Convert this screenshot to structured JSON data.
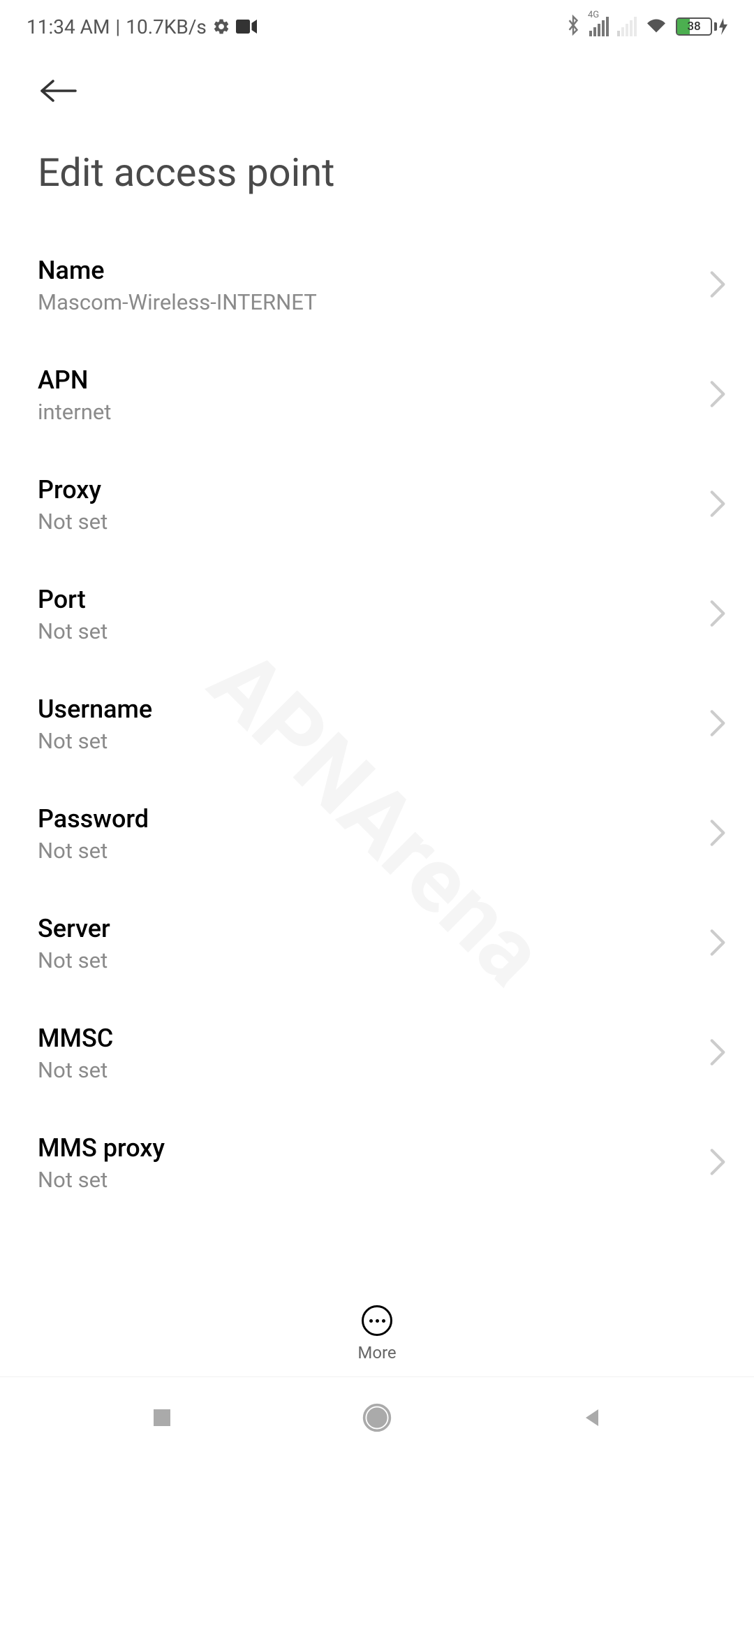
{
  "statusBar": {
    "time": "11:34 AM",
    "separator": "|",
    "dataRate": "10.7KB/s",
    "battery": "38"
  },
  "page": {
    "title": "Edit access point"
  },
  "settings": [
    {
      "label": "Name",
      "value": "Mascom-Wireless-INTERNET"
    },
    {
      "label": "APN",
      "value": "internet"
    },
    {
      "label": "Proxy",
      "value": "Not set"
    },
    {
      "label": "Port",
      "value": "Not set"
    },
    {
      "label": "Username",
      "value": "Not set"
    },
    {
      "label": "Password",
      "value": "Not set"
    },
    {
      "label": "Server",
      "value": "Not set"
    },
    {
      "label": "MMSC",
      "value": "Not set"
    },
    {
      "label": "MMS proxy",
      "value": "Not set"
    }
  ],
  "bottomMenu": {
    "more": "More"
  },
  "watermark": "APNArena"
}
